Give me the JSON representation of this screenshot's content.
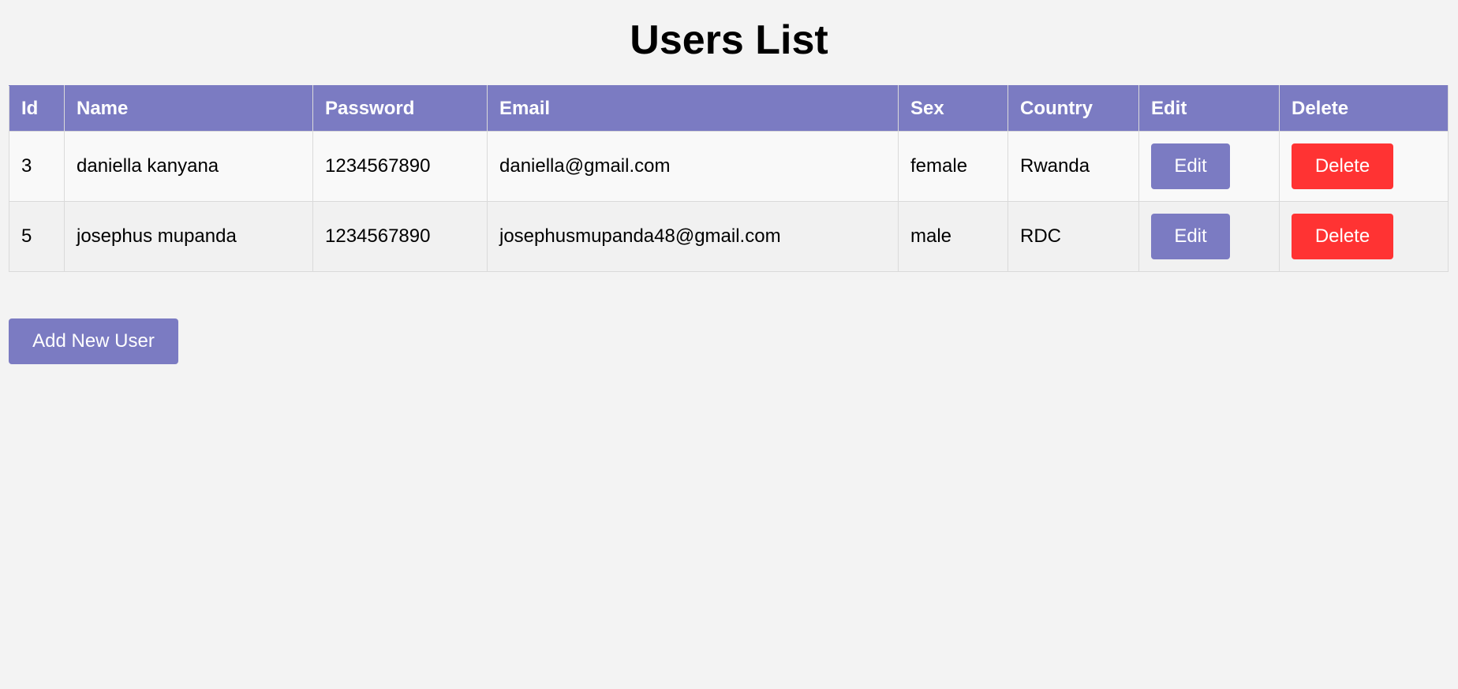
{
  "page": {
    "title": "Users List"
  },
  "table": {
    "columns": [
      "Id",
      "Name",
      "Password",
      "Email",
      "Sex",
      "Country",
      "Edit",
      "Delete"
    ],
    "rows": [
      {
        "id": "3",
        "name": "daniella kanyana",
        "password": "1234567890",
        "email": "daniella@gmail.com",
        "sex": "female",
        "country": "Rwanda",
        "edit_label": "Edit",
        "delete_label": "Delete"
      },
      {
        "id": "5",
        "name": "josephus mupanda",
        "password": "1234567890",
        "email": "josephusmupanda48@gmail.com",
        "sex": "male",
        "country": "RDC",
        "edit_label": "Edit",
        "delete_label": "Delete"
      }
    ]
  },
  "actions": {
    "add_user_label": "Add New User"
  },
  "colors": {
    "accent": "#7b7bc2",
    "danger": "#ff3333",
    "background": "#f3f3f3"
  }
}
